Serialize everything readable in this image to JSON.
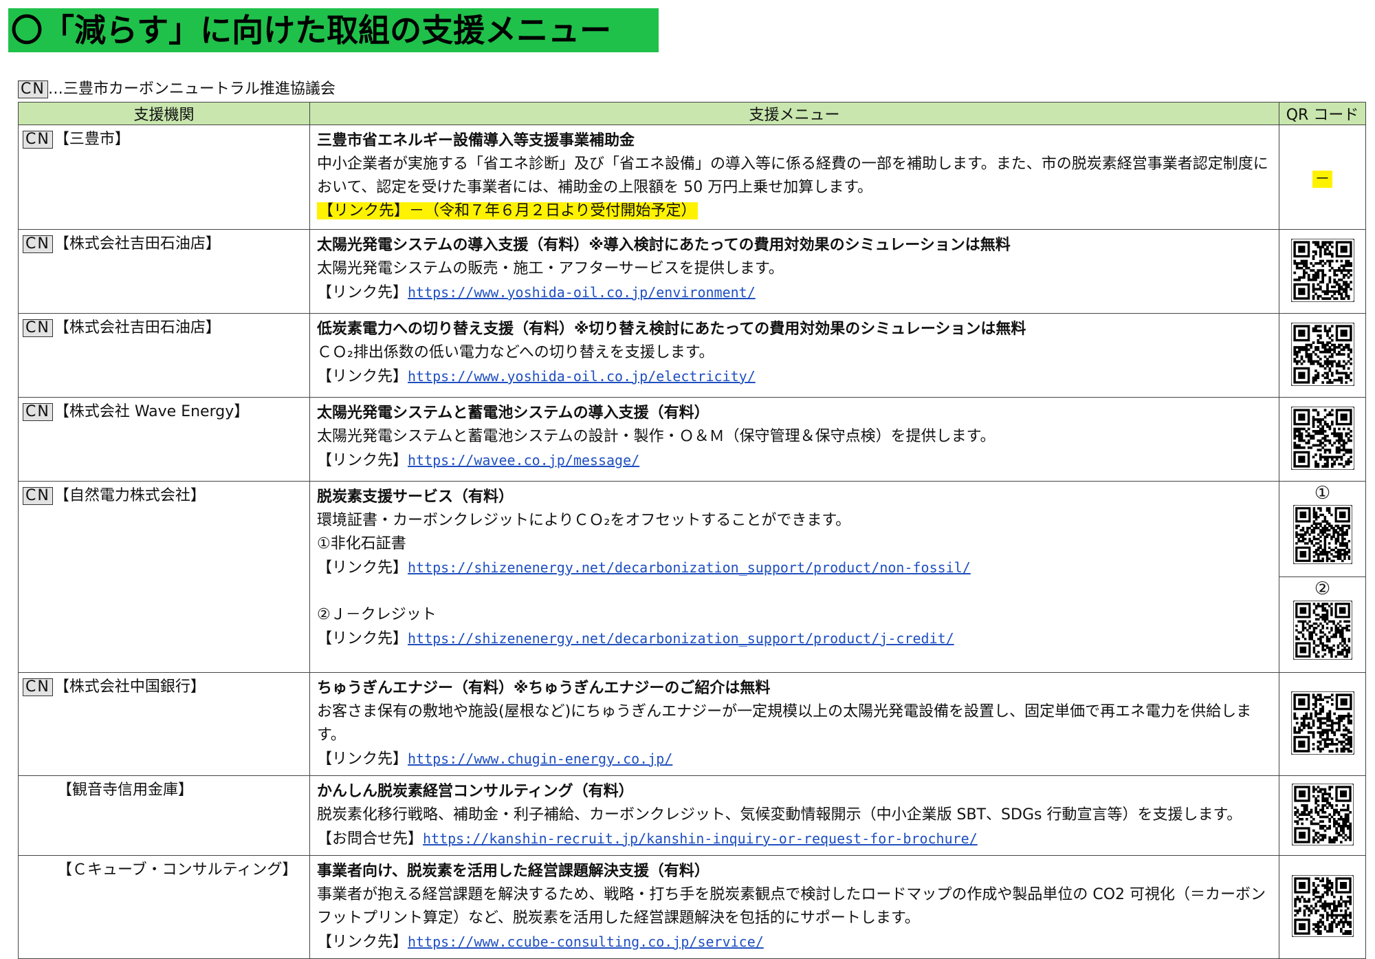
{
  "title": "〇「減らす」に向けた取組の支援メニュー",
  "legend": {
    "tag": "CN",
    "text": "…三豊市カーボンニュートラル推進協議会"
  },
  "headers": {
    "org": "支援機関",
    "menu": "支援メニュー",
    "qr": "QR コード"
  },
  "rows": [
    {
      "cn": "CN",
      "org": "【三豊市】",
      "title": "三豊市省エネルギー設備導入等支援事業補助金",
      "desc": "中小企業者が実施する「省エネ診断」及び「省エネ設備」の導入等に係る経費の一部を補助します。また、市の脱炭素経営事業者認定制度において、認定を受けた事業者には、補助金の上限額を 50 万円上乗せ加算します。",
      "link_label": "【リンク先】－（令和７年６月２日より受付開始予定）",
      "qr_text": "－"
    },
    {
      "cn": "CN",
      "org": "【株式会社吉田石油店】",
      "title": "太陽光発電システムの導入支援（有料）※導入検討にあたっての費用対効果のシミュレーションは無料",
      "desc": "太陽光発電システムの販売・施工・アフターサービスを提供します。",
      "link_label": "【リンク先】",
      "link_url": "https://www.yoshida-oil.co.jp/environment/"
    },
    {
      "cn": "CN",
      "org": "【株式会社吉田石油店】",
      "title": "低炭素電力への切り替え支援（有料）※切り替え検討にあたっての費用対効果のシミュレーションは無料",
      "desc": "ＣＯ₂排出係数の低い電力などへの切り替えを支援します。",
      "link_label": "【リンク先】",
      "link_url": "https://www.yoshida-oil.co.jp/electricity/"
    },
    {
      "cn": "CN",
      "org": "【株式会社 Wave Energy】",
      "title": "太陽光発電システムと蓄電池システムの導入支援（有料）",
      "desc": "太陽光発電システムと蓄電池システムの設計・製作・Ｏ＆Ｍ（保守管理＆保守点検）を提供します。",
      "link_label": "【リンク先】",
      "link_url": "https://wavee.co.jp/message/"
    },
    {
      "cn": "CN",
      "org": "【自然電力株式会社】",
      "title": "脱炭素支援サービス（有料）",
      "desc": "環境証書・カーボンクレジットによりＣＯ₂をオフセットすることができます。",
      "sub1_label": "①非化石証書",
      "link_label": "【リンク先】",
      "link_url": "https://shizenenergy.net/decarbonization_support/product/non-fossil/",
      "sub2_label": "②Ｊ－クレジット",
      "link2_label": "【リンク先】",
      "link2_url": "https://shizenenergy.net/decarbonization_support/product/j-credit/",
      "qr1_num": "①",
      "qr2_num": "②"
    },
    {
      "cn": "CN",
      "org": "【株式会社中国銀行】",
      "title": "ちゅうぎんエナジー（有料）※ちゅうぎんエナジーのご紹介は無料",
      "desc": "お客さま保有の敷地や施設(屋根など)にちゅうぎんエナジーが一定規模以上の太陽光発電設備を設置し、固定単価で再エネ電力を供給します。",
      "link_label": "【リンク先】",
      "link_url": "https://www.chugin-energy.co.jp/"
    },
    {
      "org": "【観音寺信用金庫】",
      "title": "かんしん脱炭素経営コンサルティング（有料）",
      "desc": "脱炭素化移行戦略、補助金・利子補給、カーボンクレジット、気候変動情報開示（中小企業版 SBT、SDGs 行動宣言等）を支援します。",
      "link_label": "【お問合せ先】",
      "link_url": "https://kanshin-recruit.jp/kanshin-inquiry-or-request-for-brochure/"
    },
    {
      "org": "【Ｃキューブ・コンサルティング】",
      "title": "事業者向け、脱炭素を活用した経営課題解決支援（有料）",
      "desc": "事業者が抱える経営課題を解決するため、戦略・打ち手を脱炭素観点で検討したロードマップの作成や製品単位の CO2 可視化（＝カーボンフットプリント算定）など、脱炭素を活用した経営課題解決を包括的にサポートします。",
      "link_label": "【リンク先】",
      "link_url": "https://www.ccube-consulting.co.jp/service/"
    }
  ]
}
